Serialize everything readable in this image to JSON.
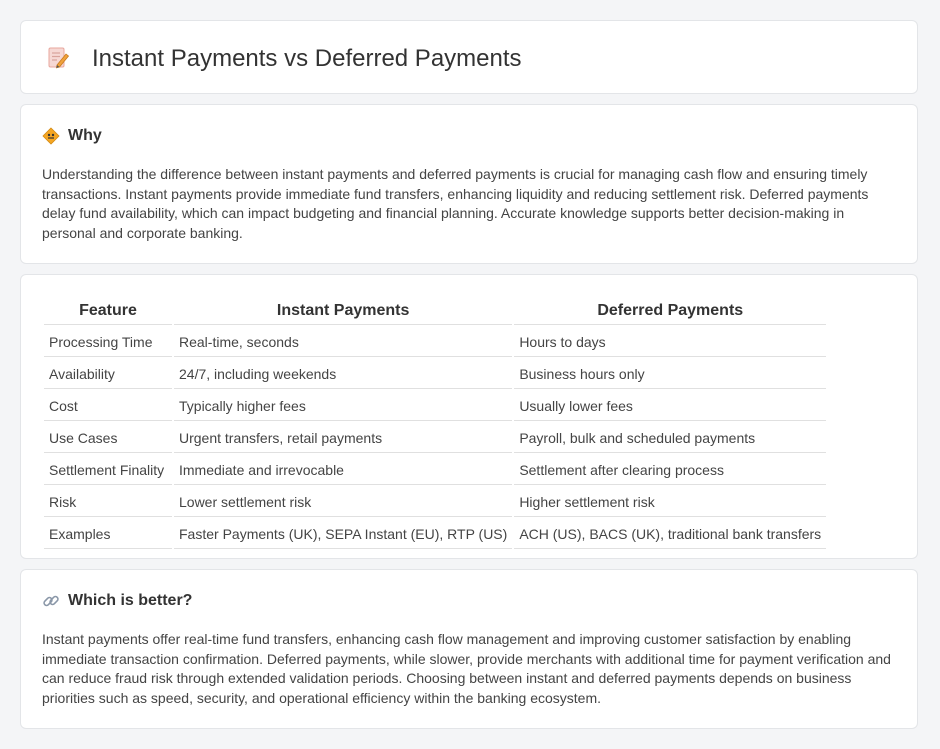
{
  "header": {
    "title": "Instant Payments vs Deferred Payments"
  },
  "why": {
    "heading": "Why",
    "body": "Understanding the difference between instant payments and deferred payments is crucial for managing cash flow and ensuring timely transactions. Instant payments provide immediate fund transfers, enhancing liquidity and reducing settlement risk. Deferred payments delay fund availability, which can impact budgeting and financial planning. Accurate knowledge supports better decision-making in personal and corporate banking."
  },
  "table": {
    "headers": [
      "Feature",
      "Instant Payments",
      "Deferred Payments"
    ],
    "rows": [
      [
        "Processing Time",
        "Real-time, seconds",
        "Hours to days"
      ],
      [
        "Availability",
        "24/7, including weekends",
        "Business hours only"
      ],
      [
        "Cost",
        "Typically higher fees",
        "Usually lower fees"
      ],
      [
        "Use Cases",
        "Urgent transfers, retail payments",
        "Payroll, bulk and scheduled payments"
      ],
      [
        "Settlement Finality",
        "Immediate and irrevocable",
        "Settlement after clearing process"
      ],
      [
        "Risk",
        "Lower settlement risk",
        "Higher settlement risk"
      ],
      [
        "Examples",
        "Faster Payments (UK), SEPA Instant (EU), RTP (US)",
        "ACH (US), BACS (UK), traditional bank transfers"
      ]
    ]
  },
  "better": {
    "heading": "Which is better?",
    "body": "Instant payments offer real-time fund transfers, enhancing cash flow management and improving customer satisfaction by enabling immediate transaction confirmation. Deferred payments, while slower, provide merchants with additional time for payment verification and can reduce fraud risk through extended validation periods. Choosing between instant and deferred payments depends on business priorities such as speed, security, and operational efficiency within the banking ecosystem."
  },
  "icons": {
    "title": "document-pencil-icon",
    "why": "diamond-sign-icon",
    "better": "link-icon"
  }
}
